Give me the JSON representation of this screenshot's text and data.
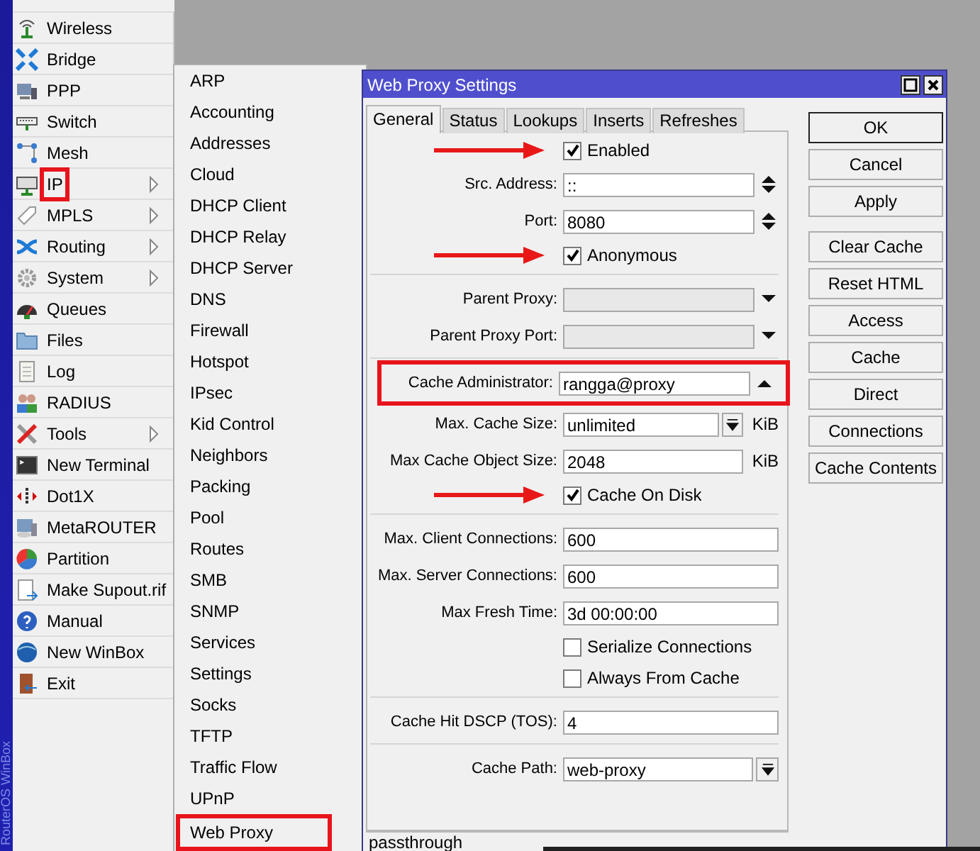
{
  "side_label": "RouterOS WinBox",
  "main_menu": [
    {
      "label": "Wireless",
      "submenu": false,
      "highlighted": false
    },
    {
      "label": "Bridge",
      "submenu": false,
      "highlighted": false
    },
    {
      "label": "PPP",
      "submenu": false,
      "highlighted": false
    },
    {
      "label": "Switch",
      "submenu": false,
      "highlighted": false
    },
    {
      "label": "Mesh",
      "submenu": false,
      "highlighted": false
    },
    {
      "label": "IP",
      "submenu": true,
      "highlighted": true
    },
    {
      "label": "MPLS",
      "submenu": true,
      "highlighted": false
    },
    {
      "label": "Routing",
      "submenu": true,
      "highlighted": false
    },
    {
      "label": "System",
      "submenu": true,
      "highlighted": false
    },
    {
      "label": "Queues",
      "submenu": false,
      "highlighted": false
    },
    {
      "label": "Files",
      "submenu": false,
      "highlighted": false
    },
    {
      "label": "Log",
      "submenu": false,
      "highlighted": false
    },
    {
      "label": "RADIUS",
      "submenu": false,
      "highlighted": false
    },
    {
      "label": "Tools",
      "submenu": true,
      "highlighted": false
    },
    {
      "label": "New Terminal",
      "submenu": false,
      "highlighted": false
    },
    {
      "label": "Dot1X",
      "submenu": false,
      "highlighted": false
    },
    {
      "label": "MetaROUTER",
      "submenu": false,
      "highlighted": false
    },
    {
      "label": "Partition",
      "submenu": false,
      "highlighted": false
    },
    {
      "label": "Make Supout.rif",
      "submenu": false,
      "highlighted": false
    },
    {
      "label": "Manual",
      "submenu": false,
      "highlighted": false
    },
    {
      "label": "New WinBox",
      "submenu": false,
      "highlighted": false
    },
    {
      "label": "Exit",
      "submenu": false,
      "highlighted": false
    }
  ],
  "ip_submenu": [
    {
      "label": "ARP",
      "highlighted": false
    },
    {
      "label": "Accounting",
      "highlighted": false
    },
    {
      "label": "Addresses",
      "highlighted": false
    },
    {
      "label": "Cloud",
      "highlighted": false
    },
    {
      "label": "DHCP Client",
      "highlighted": false
    },
    {
      "label": "DHCP Relay",
      "highlighted": false
    },
    {
      "label": "DHCP Server",
      "highlighted": false
    },
    {
      "label": "DNS",
      "highlighted": false
    },
    {
      "label": "Firewall",
      "highlighted": false
    },
    {
      "label": "Hotspot",
      "highlighted": false
    },
    {
      "label": "IPsec",
      "highlighted": false
    },
    {
      "label": "Kid Control",
      "highlighted": false
    },
    {
      "label": "Neighbors",
      "highlighted": false
    },
    {
      "label": "Packing",
      "highlighted": false
    },
    {
      "label": "Pool",
      "highlighted": false
    },
    {
      "label": "Routes",
      "highlighted": false
    },
    {
      "label": "SMB",
      "highlighted": false
    },
    {
      "label": "SNMP",
      "highlighted": false
    },
    {
      "label": "Services",
      "highlighted": false
    },
    {
      "label": "Settings",
      "highlighted": false
    },
    {
      "label": "Socks",
      "highlighted": false
    },
    {
      "label": "TFTP",
      "highlighted": false
    },
    {
      "label": "Traffic Flow",
      "highlighted": false
    },
    {
      "label": "UPnP",
      "highlighted": false
    },
    {
      "label": "Web Proxy",
      "highlighted": true
    }
  ],
  "window": {
    "title": "Web Proxy Settings",
    "tabs": [
      {
        "label": "General",
        "selected": true
      },
      {
        "label": "Status",
        "selected": false
      },
      {
        "label": "Lookups",
        "selected": false
      },
      {
        "label": "Inserts",
        "selected": false
      },
      {
        "label": "Refreshes",
        "selected": false
      }
    ],
    "form": [
      {
        "kind": "checkbox",
        "label": "Enabled",
        "checked": true,
        "pointed": true
      },
      {
        "kind": "field",
        "label": "Src. Address:",
        "value": "::",
        "control": {
          "kind": "spin"
        },
        "disabled": false,
        "highlighted": false
      },
      {
        "kind": "field",
        "label": "Port:",
        "value": "8080",
        "control": {
          "kind": "spin"
        },
        "disabled": false,
        "highlighted": false
      },
      {
        "kind": "checkbox",
        "label": "Anonymous",
        "checked": true,
        "pointed": true
      },
      {
        "kind": "divider"
      },
      {
        "kind": "field",
        "label": "Parent Proxy:",
        "control": {
          "kind": "down"
        },
        "disabled": true,
        "highlighted": false
      },
      {
        "kind": "field",
        "label": "Parent Proxy Port:",
        "control": {
          "kind": "down"
        },
        "disabled": true,
        "highlighted": false
      },
      {
        "kind": "divider"
      },
      {
        "kind": "field",
        "label": "Cache Administrator:",
        "value": "rangga@proxy",
        "control": {
          "kind": "up"
        },
        "disabled": false,
        "highlighted": true
      },
      {
        "kind": "field",
        "label": "Max. Cache Size:",
        "value": "unlimited",
        "control": {
          "kind": "dropdown"
        },
        "unit": "KiB",
        "disabled": false,
        "highlighted": false
      },
      {
        "kind": "field",
        "label": "Max Cache Object Size:",
        "value": "2048",
        "unit": "KiB",
        "disabled": false,
        "highlighted": false
      },
      {
        "kind": "checkbox",
        "label": "Cache On Disk",
        "checked": true,
        "pointed": true
      },
      {
        "kind": "divider"
      },
      {
        "kind": "field",
        "label": "Max. Client Connections:",
        "value": "600",
        "disabled": false,
        "highlighted": false
      },
      {
        "kind": "field",
        "label": "Max. Server Connections:",
        "value": "600",
        "disabled": false,
        "highlighted": false
      },
      {
        "kind": "field",
        "label": "Max Fresh Time:",
        "value": "3d 00:00:00",
        "disabled": false,
        "highlighted": false
      },
      {
        "kind": "checkbox",
        "label": "Serialize Connections",
        "checked": false,
        "pointed": false
      },
      {
        "kind": "checkbox",
        "label": "Always From Cache",
        "checked": false,
        "pointed": false
      },
      {
        "kind": "divider"
      },
      {
        "kind": "field",
        "label": "Cache Hit DSCP (TOS):",
        "value": "4",
        "disabled": false,
        "highlighted": false
      },
      {
        "kind": "divider"
      },
      {
        "kind": "field",
        "label": "Cache Path:",
        "value": "web-proxy",
        "control": {
          "kind": "dropdown"
        },
        "disabled": false,
        "highlighted": false
      }
    ],
    "button_groups": [
      {
        "buttons": [
          {
            "label": "OK",
            "default": true
          },
          {
            "label": "Cancel",
            "default": false
          },
          {
            "label": "Apply",
            "default": false
          }
        ]
      },
      {
        "buttons": [
          {
            "label": "Clear Cache",
            "default": false
          },
          {
            "label": "Reset HTML",
            "default": false
          },
          {
            "label": "Access",
            "default": false
          },
          {
            "label": "Cache",
            "default": false
          },
          {
            "label": "Direct",
            "default": false
          },
          {
            "label": "Connections",
            "default": false
          },
          {
            "label": "Cache Contents",
            "default": false
          }
        ]
      }
    ],
    "status_text": "passthrough"
  }
}
